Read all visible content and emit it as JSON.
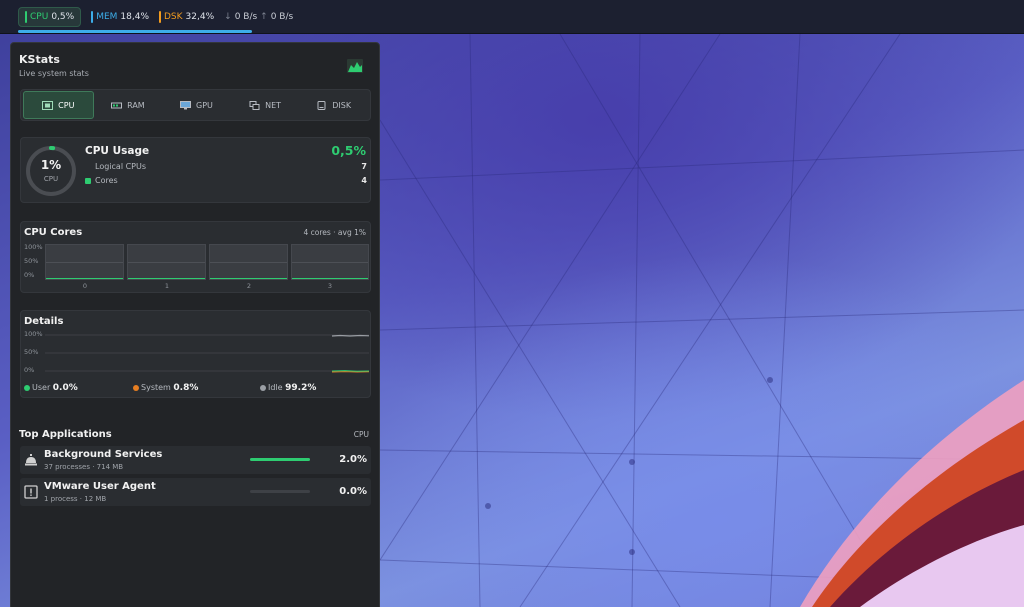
{
  "tray": {
    "cpu_label": "CPU",
    "cpu_value": "0,5%",
    "mem_label": "MEM",
    "mem_value": "18,4%",
    "dsk_label": "DSK",
    "dsk_value": "32,4%",
    "net_down": "0 B/s",
    "net_up": "0 B/s"
  },
  "widget": {
    "title": "KStats",
    "subtitle": "Live system stats",
    "tabs": [
      {
        "label": "CPU",
        "active": true
      },
      {
        "label": "RAM",
        "active": false
      },
      {
        "label": "GPU",
        "active": false
      },
      {
        "label": "NET",
        "active": false
      },
      {
        "label": "DISK",
        "active": false
      }
    ],
    "usage": {
      "ring_percent": "1%",
      "ring_label": "CPU",
      "ring_fraction": 0.01,
      "title": "CPU Usage",
      "value": "0,5%",
      "logical_label": "Logical CPUs",
      "logical_value": "7",
      "cores_label": "Cores",
      "cores_value": "4"
    },
    "cores": {
      "title": "CPU Cores",
      "meta": "4 cores · avg 1%",
      "y_labels": [
        "100%",
        "50%",
        "0%"
      ],
      "core_labels": [
        "0",
        "1",
        "2",
        "3"
      ]
    },
    "details": {
      "title": "Details",
      "y_labels": [
        "100%",
        "50%",
        "0%"
      ],
      "user_label": "User",
      "user_value": "0.0%",
      "system_label": "System",
      "system_value": "0.8%",
      "idle_label": "Idle",
      "idle_value": "99.2%"
    },
    "apps": {
      "title": "Top Applications",
      "column": "CPU",
      "items": [
        {
          "name": "Background Services",
          "sub": "37 processes · 714 MB",
          "value": "2.0%",
          "fraction": 1.0
        },
        {
          "name": "VMware User Agent",
          "sub": "1 process · 12 MB",
          "value": "0.0%",
          "fraction": 0.0
        }
      ]
    }
  },
  "colors": {
    "accent_green": "#2ecc71",
    "mem_blue": "#3daee9",
    "disk_orange": "#f39c1f",
    "system_orange": "#e67e22",
    "idle_gray": "#9a9ea4"
  }
}
